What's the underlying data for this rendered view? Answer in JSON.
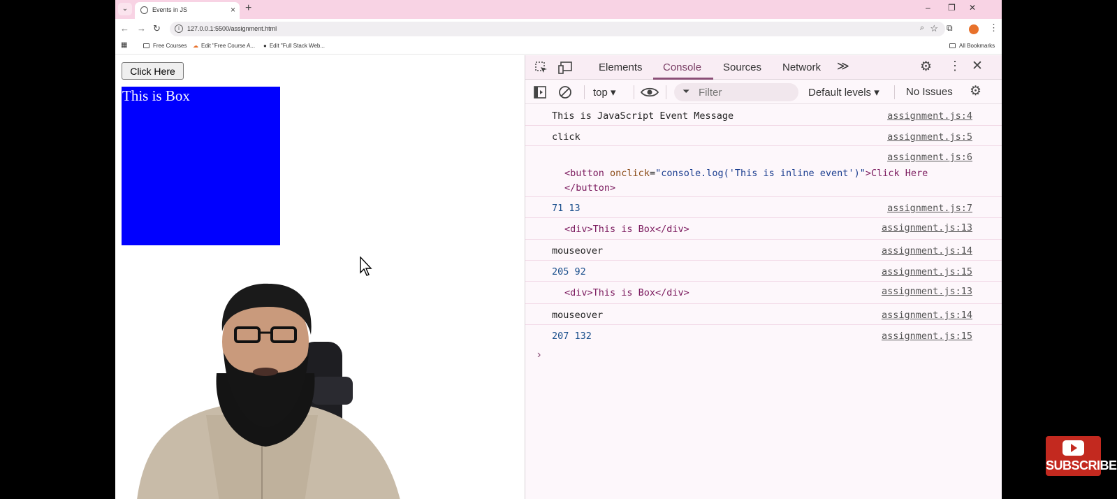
{
  "browser": {
    "tab_title": "Events in JS",
    "url": "127.0.0.1:5500/assignment.html",
    "bookmarks": [
      "Free Courses",
      "Edit \"Free Course A...",
      "Edit \"Full Stack Web..."
    ],
    "all_bookmarks": "All Bookmarks"
  },
  "page": {
    "button_label": "Click Here",
    "box_text": "This is Box",
    "box_color": "#0000ff"
  },
  "devtools": {
    "tabs": [
      "Elements",
      "Console",
      "Sources",
      "Network"
    ],
    "active_tab": "Console",
    "context": "top",
    "filter_placeholder": "Filter",
    "levels": "Default levels",
    "issues": "No Issues",
    "logs": [
      {
        "message": "This is JavaScript Event Message",
        "source": "assignment.js:4"
      },
      {
        "message": "click",
        "source": "assignment.js:5"
      },
      {
        "element": {
          "open": "<button",
          "attr": "onclick",
          "value": "\"console.log('This is inline event')\"",
          "text": ">Click Here",
          "close": "</button>"
        },
        "source": "assignment.js:6"
      },
      {
        "message": "71 13",
        "source": "assignment.js:7"
      },
      {
        "message": "<div>This is Box</div>",
        "source": "assignment.js:13"
      },
      {
        "message": "mouseover",
        "source": "assignment.js:14"
      },
      {
        "message": "205 92",
        "source": "assignment.js:15"
      },
      {
        "message": "<div>This is Box</div>",
        "source": "assignment.js:13"
      },
      {
        "message": "mouseover",
        "source": "assignment.js:14"
      },
      {
        "message": "207 132",
        "source": "assignment.js:15"
      }
    ]
  },
  "overlay": {
    "subscribe_label": "SUBSCRIBE",
    "subscribe_color": "#c3291f"
  }
}
